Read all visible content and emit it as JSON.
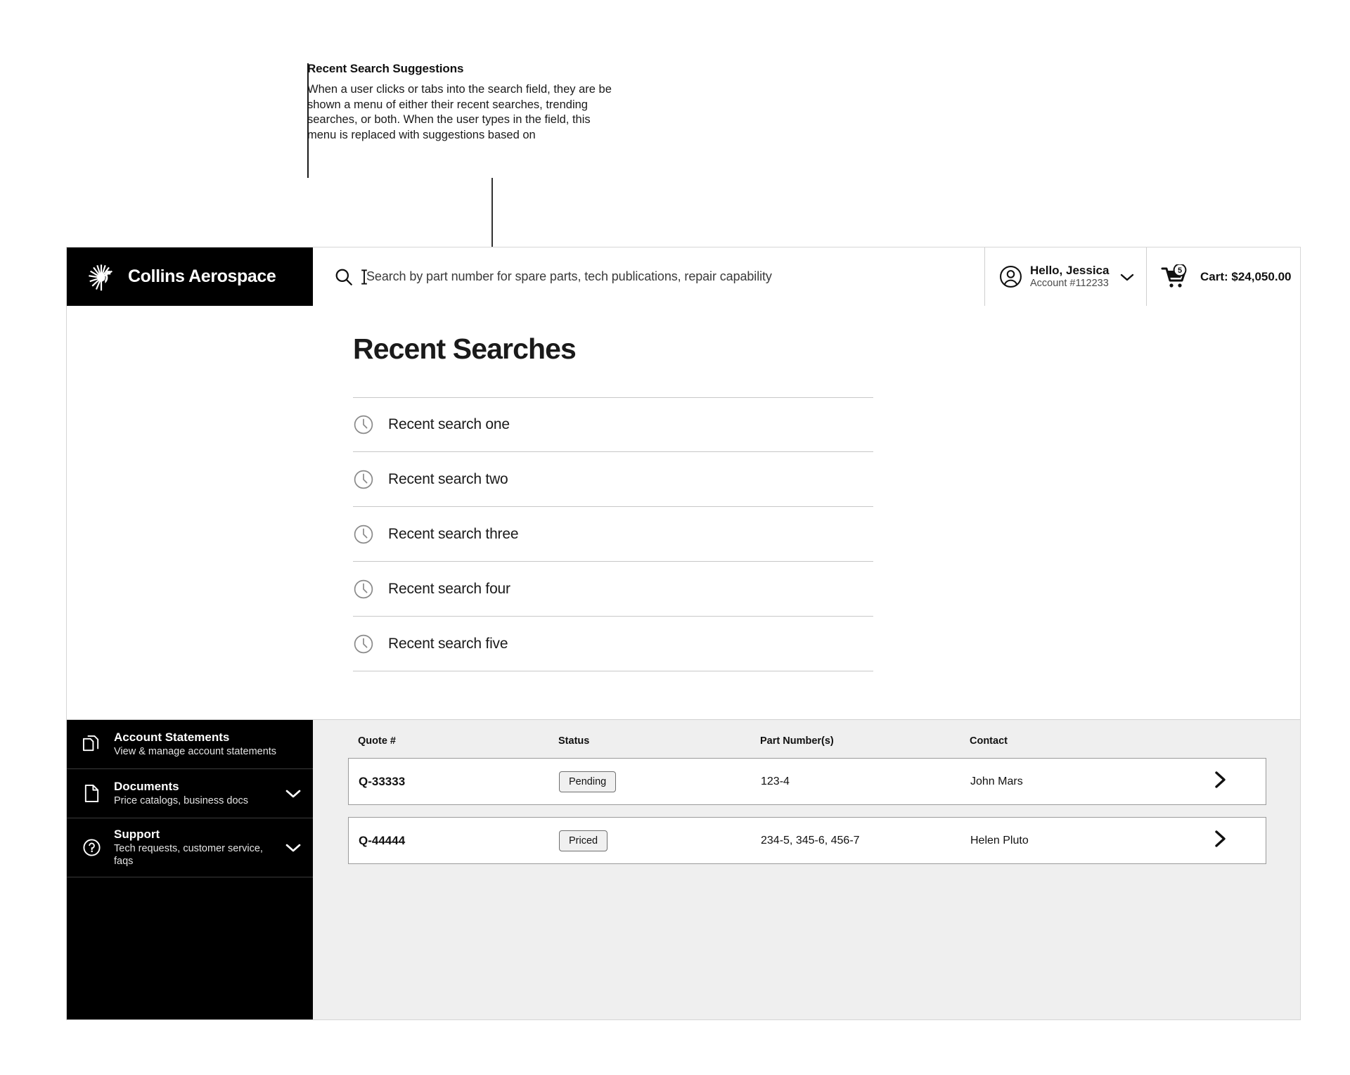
{
  "annotation": {
    "title": "Recent Search Suggestions",
    "body": "When a user clicks or tabs into the search field, they are be shown a menu of either their recent searches, trending searches, or both. When the user types in the field, this menu is replaced with suggestions based on"
  },
  "header": {
    "brand_name": "Collins Aerospace",
    "brand_logo_icon": "sunburst-logo-icon",
    "search": {
      "icon": "search-icon",
      "placeholder": "Search by part number for spare parts, tech publications, repair capability",
      "value": ""
    },
    "account": {
      "avatar_icon": "user-circle-icon",
      "greeting": "Hello, Jessica",
      "account_number": "Account #112233",
      "chevron_icon": "chevron-down-icon"
    },
    "cart": {
      "icon": "shopping-cart-icon",
      "count": "5",
      "label": "Cart: $24,050.00"
    }
  },
  "dropdown": {
    "title": "Recent Searches",
    "items": [
      {
        "icon": "clock-icon",
        "label": "Recent search one"
      },
      {
        "icon": "clock-icon",
        "label": "Recent search two"
      },
      {
        "icon": "clock-icon",
        "label": "Recent search three"
      },
      {
        "icon": "clock-icon",
        "label": "Recent search four"
      },
      {
        "icon": "clock-icon",
        "label": "Recent search five"
      }
    ]
  },
  "sidebar": {
    "items": [
      {
        "icon": "copy-documents-icon",
        "title": "Account Statements",
        "subtitle": "View & manage account statements",
        "has_chevron": false
      },
      {
        "icon": "document-icon",
        "title": "Documents",
        "subtitle": "Price catalogs, business docs",
        "has_chevron": true,
        "chevron_icon": "chevron-down-icon"
      },
      {
        "icon": "question-circle-icon",
        "title": "Support",
        "subtitle": "Tech requests, customer service, faqs",
        "has_chevron": true,
        "chevron_icon": "chevron-down-icon"
      }
    ]
  },
  "quotes_table": {
    "columns": [
      "Quote #",
      "Status",
      "Part Number(s)",
      "Contact"
    ],
    "rows": [
      {
        "quote": "Q-33333",
        "status": "Pending",
        "parts": "123-4",
        "contact": "John Mars",
        "action_icon": "chevron-right-icon"
      },
      {
        "quote": "Q-44444",
        "status": "Priced",
        "parts": "234-5, 345-6, 456-7",
        "contact": "Helen Pluto",
        "action_icon": "chevron-right-icon"
      }
    ]
  },
  "colors": {
    "brand_black": "#000000",
    "page_background": "#ffffff",
    "content_background": "#efefef",
    "divider": "#c8c8c8"
  }
}
